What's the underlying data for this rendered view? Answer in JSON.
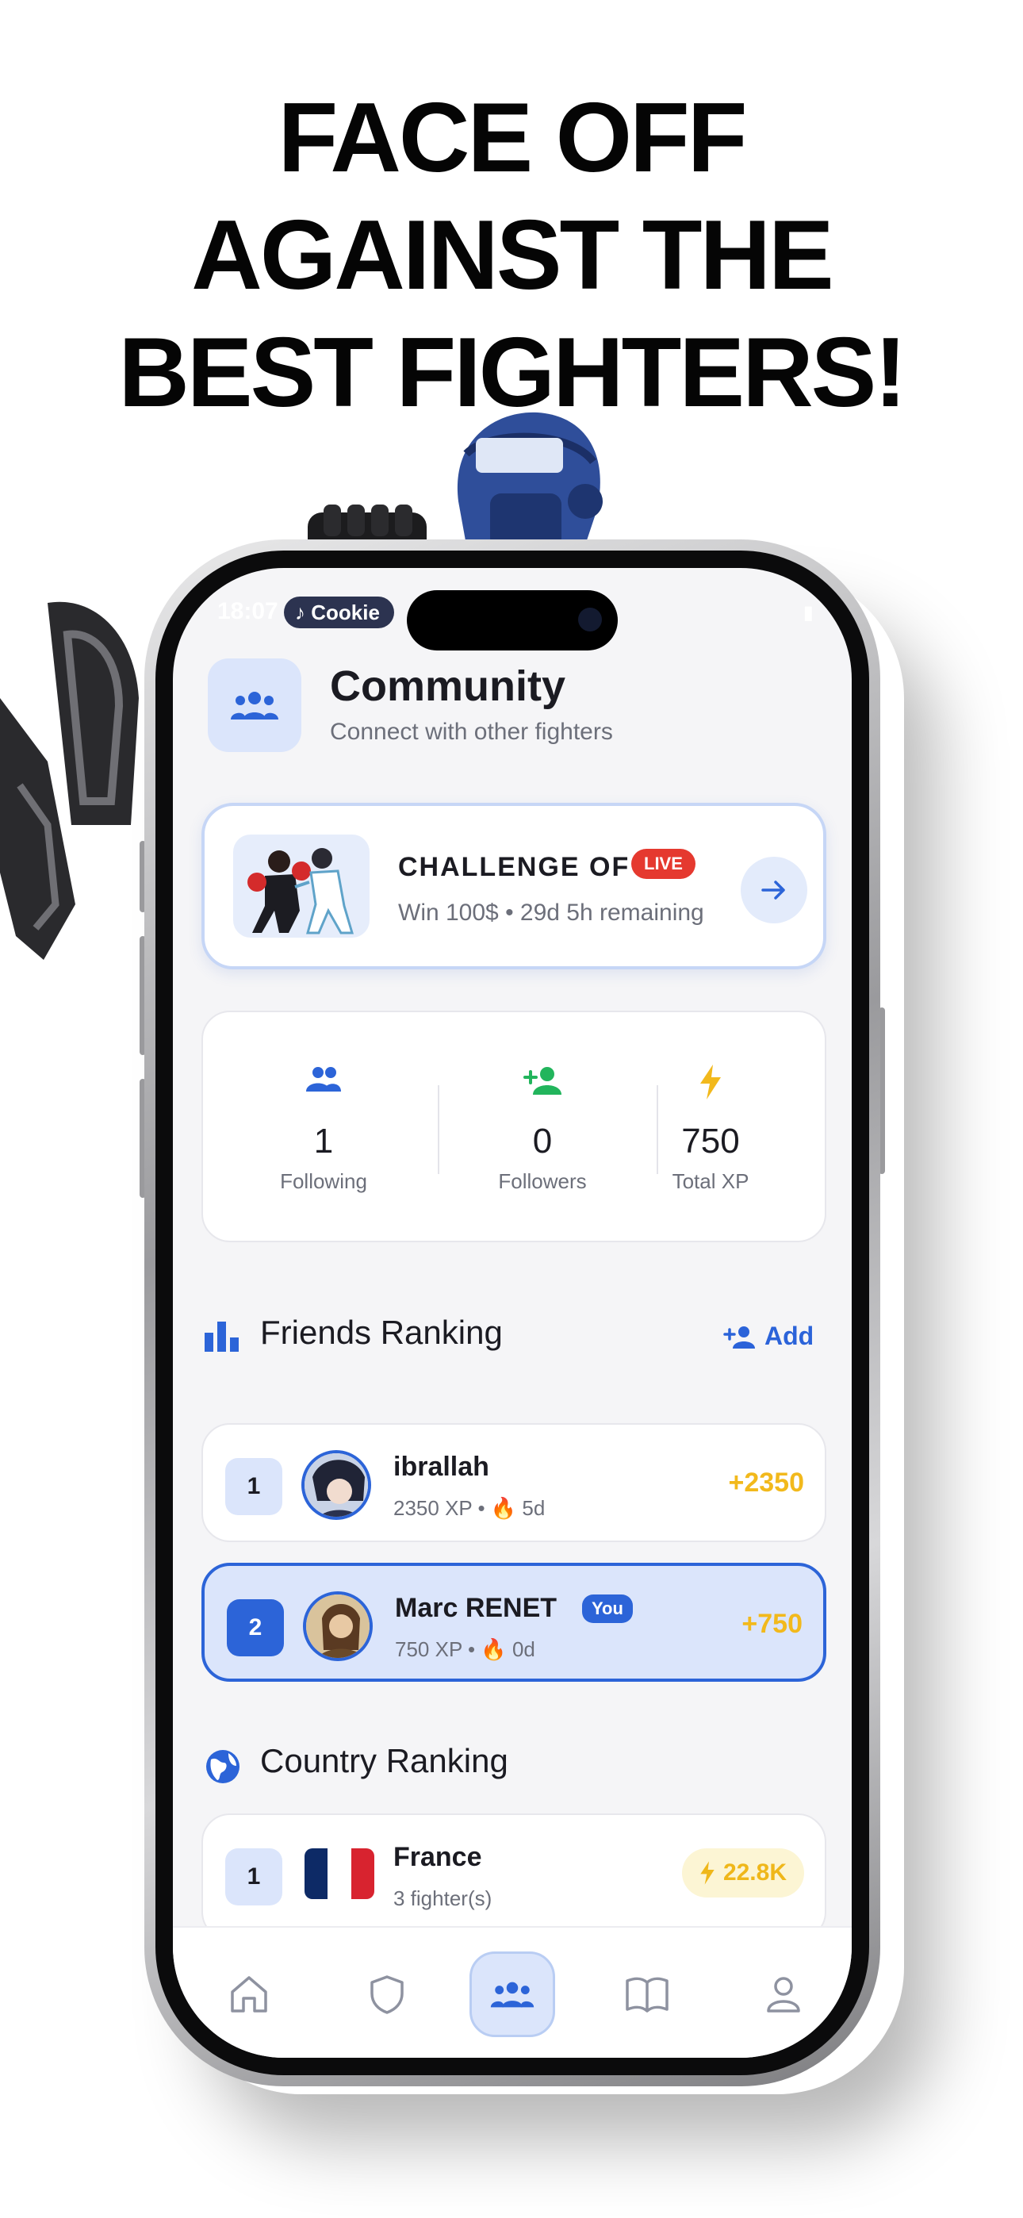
{
  "headline": [
    "FACE OFF",
    "AGAINST THE",
    "BEST FIGHTERS!"
  ],
  "status_bar": {
    "time": "18:07",
    "pill_label": "Cookie"
  },
  "header": {
    "title": "Community",
    "subtitle": "Connect with other fighters"
  },
  "challenge": {
    "title": "CHALLENGE OF ...",
    "badge": "LIVE",
    "subtitle": "Win 100$ • 29d 5h remaining"
  },
  "stats": [
    {
      "value": "1",
      "label": "Following",
      "icon": "people-icon"
    },
    {
      "value": "0",
      "label": "Followers",
      "icon": "person-add-icon"
    },
    {
      "value": "750",
      "label": "Total XP",
      "icon": "bolt-icon"
    }
  ],
  "friends_ranking": {
    "title": "Friends Ranking",
    "add_label": "Add",
    "rows": [
      {
        "rank": "1",
        "name": "ibrallah",
        "sub": "2350 XP • 🔥 5d",
        "points": "+2350",
        "is_me": false
      },
      {
        "rank": "2",
        "name": "Marc RENET",
        "sub": "750 XP • 🔥 0d",
        "points": "+750",
        "is_me": true,
        "badge": "You"
      }
    ]
  },
  "country_ranking": {
    "title": "Country Ranking",
    "rows": [
      {
        "rank": "1",
        "name": "France",
        "sub": "3 fighter(s)",
        "xp": "22.8K"
      }
    ]
  },
  "tabbar": [
    "home-icon",
    "shield-icon",
    "community-icon",
    "book-icon",
    "profile-icon"
  ],
  "colors": {
    "accent": "#2c64d8",
    "accent_soft": "#dbe5fb",
    "live": "#e5392f",
    "gold": "#f2b91c",
    "green": "#22b55c"
  }
}
